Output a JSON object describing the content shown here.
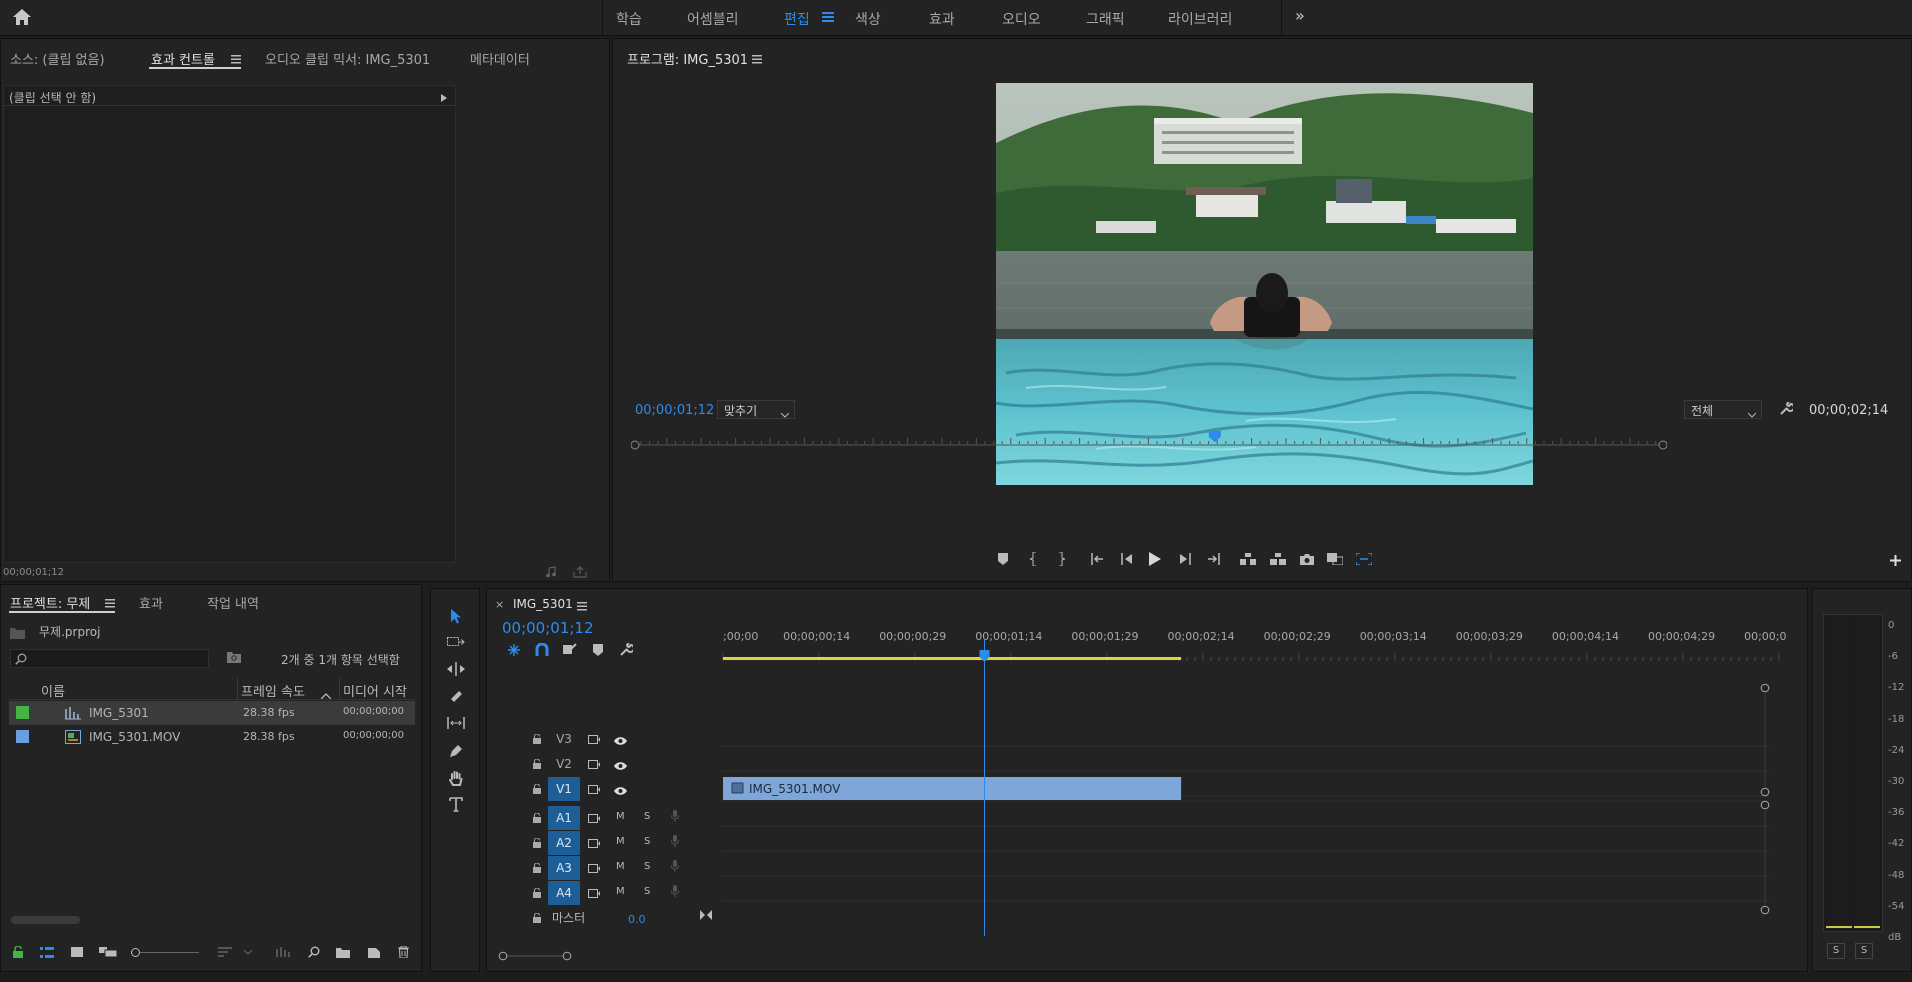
{
  "workspaces": {
    "items": [
      "학습",
      "어셈블리",
      "편집",
      "색상",
      "효과",
      "오디오",
      "그래픽",
      "라이브러리"
    ],
    "active": "편집",
    "more_label": "»"
  },
  "source_panel": {
    "tabs": [
      "소스: (클립 없음)",
      "효과 컨트롤",
      "오디오 클립 믹서: IMG_5301",
      "메타데이터"
    ],
    "active_tab": "효과 컨트롤",
    "no_clip_text": "(클립 선택 안 함)",
    "timecode": "00;00;01;12"
  },
  "program_monitor": {
    "title": "프로그램: IMG_5301",
    "current_timecode": "00;00;01;12",
    "zoom_select": "맞추기",
    "quality_select": "전체",
    "duration_timecode": "00;00;02;14",
    "playhead_fraction": 0.564
  },
  "project_panel": {
    "tabs": [
      "프로젝트: 무제",
      "효과",
      "작업 내역"
    ],
    "active_tab": "프로젝트: 무제",
    "project_file": "무제.prproj",
    "search_placeholder": "",
    "selection_status": "2개 중 1개 항목 선택함",
    "columns": [
      "이름",
      "프레임 속도",
      "미디어 시작"
    ],
    "items": [
      {
        "color": "#45b445",
        "type": "sequence",
        "name": "IMG_5301",
        "fps": "28.38 fps",
        "start": "00;00;00;00",
        "selected": true
      },
      {
        "color": "#6a9ee0",
        "type": "clip",
        "name": "IMG_5301.MOV",
        "fps": "28.38 fps",
        "start": "00;00;00;00",
        "selected": false
      }
    ]
  },
  "timeline": {
    "sequence_tab": "IMG_5301",
    "timecode": "00;00;01;12",
    "ruler_labels": [
      ";00;00",
      "00;00;00;14",
      "00;00;00;29",
      "00;00;01;14",
      "00;00;01;29",
      "00;00;02;14",
      "00;00;02;29",
      "00;00;03;14",
      "00;00;03;29",
      "00;00;04;14",
      "00;00;04;29",
      "00;00;0"
    ],
    "video_tracks": [
      "V3",
      "V2",
      "V1"
    ],
    "audio_tracks": [
      "A1",
      "A2",
      "A3",
      "A4"
    ],
    "mute_label": "M",
    "solo_label": "S",
    "master_label": "마스터",
    "master_value": "0.0",
    "clip_name": "IMG_5301.MOV",
    "clip_end_seconds": 2.47,
    "playhead_seconds": 1.41
  },
  "audio_meter": {
    "scale": [
      "0",
      "-6",
      "-12",
      "-18",
      "-24",
      "-30",
      "-36",
      "-42",
      "-48",
      "-54",
      "dB"
    ],
    "solo_buttons": [
      "S",
      "S"
    ]
  },
  "colors": {
    "accent_blue": "#2d8ceb",
    "clip_blue": "#7ea6d8",
    "track_on": "#1c5e95",
    "work_area": "#e3d23a",
    "sequence_green": "#45b445"
  }
}
